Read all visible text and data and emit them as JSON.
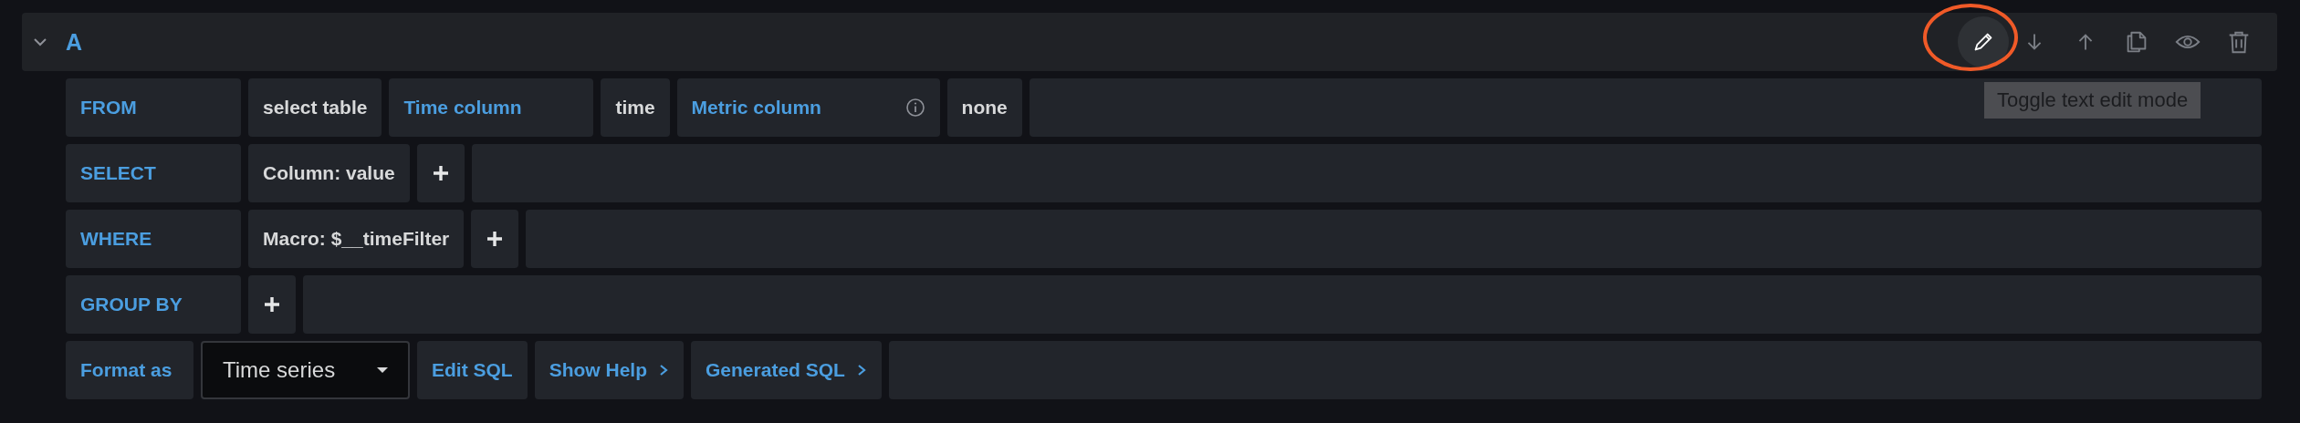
{
  "query": {
    "ref_id": "A",
    "expanded": true,
    "actions": [
      {
        "kind": "edit",
        "hovered": true
      },
      {
        "kind": "down",
        "hovered": false
      },
      {
        "kind": "up",
        "hovered": false
      },
      {
        "kind": "copy",
        "hovered": false
      },
      {
        "kind": "eye",
        "hovered": false
      },
      {
        "kind": "trash",
        "hovered": false
      }
    ],
    "tooltip": "Toggle text edit mode",
    "rows": [
      {
        "label": "FROM",
        "parts": [
          {
            "kind": "value",
            "text": "select table"
          },
          {
            "kind": "keyword",
            "text": "Time column"
          },
          {
            "kind": "value",
            "text": "time"
          },
          {
            "kind": "keyword",
            "text": "Metric column",
            "info": true
          },
          {
            "kind": "value",
            "text": "none"
          }
        ]
      },
      {
        "label": "SELECT",
        "parts": [
          {
            "kind": "value",
            "text": "Column: value"
          },
          {
            "kind": "add"
          }
        ]
      },
      {
        "label": "WHERE",
        "parts": [
          {
            "kind": "value",
            "text": "Macro: $__timeFilter"
          },
          {
            "kind": "add"
          }
        ]
      },
      {
        "label": "GROUP BY",
        "parts": [
          {
            "kind": "add"
          }
        ]
      },
      {
        "label": "Format as",
        "parts": [
          {
            "kind": "select",
            "text": "Time series"
          },
          {
            "kind": "link",
            "text": "Edit SQL"
          },
          {
            "kind": "expander",
            "text": "Show Help"
          },
          {
            "kind": "expander",
            "text": "Generated SQL"
          }
        ]
      }
    ]
  }
}
